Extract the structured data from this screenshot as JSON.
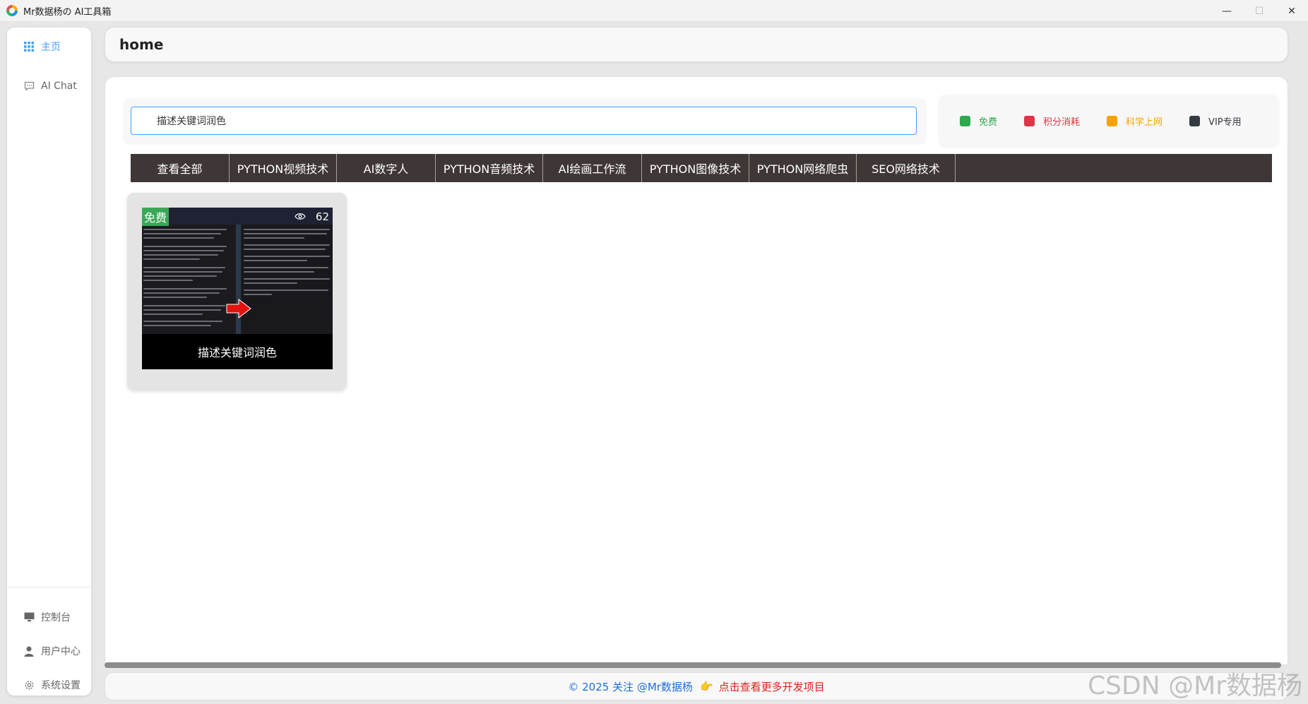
{
  "window": {
    "title": "Mr数据杨の AI工具箱",
    "minimize": "—",
    "maximize": "☐",
    "close": "✕"
  },
  "sidebar": {
    "top_items": [
      {
        "label": "主页",
        "icon": "grid-icon",
        "active": true
      },
      {
        "label": "AI Chat",
        "icon": "chat-icon",
        "active": false
      }
    ],
    "bottom_items": [
      {
        "label": "控制台",
        "icon": "monitor-icon"
      },
      {
        "label": "用户中心",
        "icon": "user-icon"
      },
      {
        "label": "系统设置",
        "icon": "gear-icon"
      }
    ]
  },
  "header": {
    "title": "home"
  },
  "search": {
    "value": "描述关键词润色",
    "accent": "#409eff"
  },
  "legend": [
    {
      "label": "免费",
      "color": "#2fa84f"
    },
    {
      "label": "积分消耗",
      "color": "#dc3545"
    },
    {
      "label": "科学上网",
      "color": "#f5a200"
    },
    {
      "label": "VIP专用",
      "color": "#343a40"
    }
  ],
  "categories": [
    "查看全部",
    "PYTHON视频技术",
    "AI数字人",
    "PYTHON音频技术",
    "AI绘画工作流",
    "PYTHON图像技术",
    "PYTHON网络爬虫",
    "SEO网络技术"
  ],
  "cards": [
    {
      "badge": "免费",
      "views": "62",
      "caption": "描述关键词润色"
    }
  ],
  "footer": {
    "copyright": "© 2025 关注 @Mr数据杨",
    "hand": "👉",
    "link": "点击查看更多开发项目"
  },
  "watermark": "CSDN @Mr数据杨"
}
